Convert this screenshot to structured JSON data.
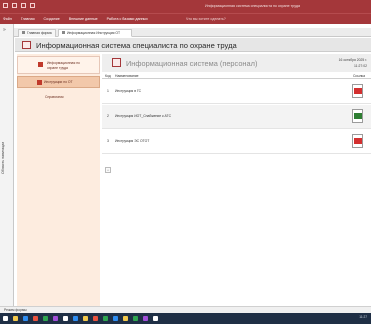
{
  "window": {
    "title": "Информационная система специалиста по охране труда"
  },
  "ribbon": {
    "tabs": [
      "Файл",
      "Главная",
      "Создание",
      "Внешние данные",
      "Работа с базами данных"
    ],
    "search_placeholder": "Что вы хотите сделать?"
  },
  "navpane": {
    "label": "Область навигации"
  },
  "doc_tabs": [
    {
      "label": "Главная форма"
    },
    {
      "label": "Информационная Инструкция ОТ"
    }
  ],
  "form": {
    "header_title": "Информационная система специалиста по охране труда",
    "leftnav": [
      {
        "label": "Информационная по охране труда"
      },
      {
        "label": "Инструкции по ОТ"
      },
      {
        "label": "Справочник"
      }
    ],
    "content": {
      "title": "Информационная система (персонал)",
      "date": "16 октября 2025 г.",
      "time": "11:27:02",
      "columns": {
        "code": "Код",
        "name": "Наименование",
        "link": "Ссылка"
      },
      "rows": [
        {
          "num": "1",
          "name": "Инструкция в ГС",
          "icon": "pdf-icon",
          "type": "pdf"
        },
        {
          "num": "2",
          "name": "Инструкция ИОТ_Снабжение к АТС",
          "icon": "excel-icon",
          "type": "xls"
        },
        {
          "num": "3",
          "name": "Инструкция ЭС ОТОТ",
          "icon": "pdf-icon",
          "type": "pdf"
        }
      ]
    }
  },
  "statusbar": {
    "text": "Режим формы"
  },
  "taskbar": {
    "clock": "11:27",
    "icon_colors": [
      "#ffffff",
      "#f3c94d",
      "#2d8cf0",
      "#e8533f",
      "#2ea44f",
      "#a14fd8",
      "#ffffff",
      "#2d8cf0",
      "#f3c94d",
      "#e8533f",
      "#2ea44f",
      "#2d8cf0",
      "#f3c94d",
      "#2ea44f",
      "#a14fd8",
      "#ffffff"
    ]
  }
}
